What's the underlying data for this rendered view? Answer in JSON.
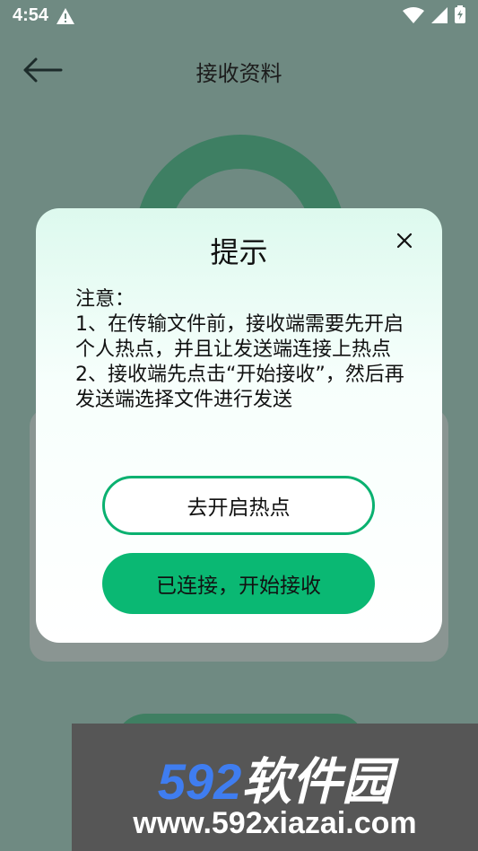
{
  "status_bar": {
    "time": "4:54"
  },
  "app_bar": {
    "title": "接收资料"
  },
  "dialog": {
    "title": "提示",
    "message_title": "注意：",
    "message_body": "1、在传输文件前，接收端需要先开启个人热点，并且让发送端连接上热点 2、接收端先点击“开始接收”，然后再发送端选择文件进行发送",
    "button_primary": "去开启热点",
    "button_secondary": "已连接，开始接收"
  },
  "watermark": {
    "brand_number": "592",
    "brand_text": "软件园",
    "url": "www.592xiazai.com"
  },
  "colors": {
    "overlay_bg": "#6f8a82",
    "accent_green": "#0ab873",
    "ring_green": "#3e7f63"
  },
  "icons": [
    "warning-icon",
    "wifi-icon",
    "signal-icon",
    "battery-icon",
    "back-arrow-icon",
    "close-icon"
  ]
}
